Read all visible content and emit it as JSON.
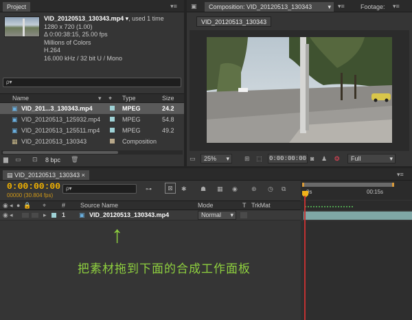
{
  "project": {
    "tab": "Project",
    "file_name": "VID_20120513_130343.mp4",
    "used_count": ", used 1 time",
    "resolution": "1280 x 720 (1.00)",
    "duration": "Δ 0:00:38:15, 25.00 fps",
    "colors": "Millions of Colors",
    "codec": "H.264",
    "audio": "16.000 kHz / 32 bit U / Mono",
    "search_placeholder": "ρ▾",
    "columns": {
      "name": "Name",
      "type": "Type",
      "size": "Size"
    },
    "items": [
      {
        "name": "VID_201...3_130343.mp4",
        "type": "MPEG",
        "size": "24.2",
        "swatch": "#9fd2d6",
        "selected": true
      },
      {
        "name": "VID_20120513_125932.mp4",
        "type": "MPEG",
        "size": "54.8",
        "swatch": "#9fd2d6",
        "selected": false
      },
      {
        "name": "VID_20120513_125511.mp4",
        "type": "MPEG",
        "size": "49.2",
        "swatch": "#9fd2d6",
        "selected": false
      },
      {
        "name": "VID_20120513_130343",
        "type": "Composition",
        "size": "",
        "swatch": "#b8a88a",
        "selected": false
      }
    ],
    "bpc": "8 bpc"
  },
  "composition": {
    "tab": "Composition: VID_20120513_130343",
    "footage_tab": "Footage:",
    "subtab": "VID_20120513_130343",
    "zoom": "25%",
    "timecode": "0:00:00:00",
    "resolution": "Full"
  },
  "timeline": {
    "tab": "VID_20120513_130343",
    "timecode": "0:00:00:00",
    "frames": "00000 (30.804 fps)",
    "search_placeholder": "ρ▾",
    "ruler_start": "0s",
    "ruler_mark": "00:15s",
    "columns": {
      "number": "#",
      "source_name": "Source Name",
      "mode": "Mode",
      "t": "T",
      "trkmat": "TrkMat"
    },
    "layer": {
      "index": "1",
      "name": "VID_20120513_130343.mp4",
      "mode": "Normal"
    }
  },
  "annotation": {
    "arrow": "↑",
    "text": "把素材拖到下面的合成工作面板",
    "color": "#8fd13f"
  }
}
